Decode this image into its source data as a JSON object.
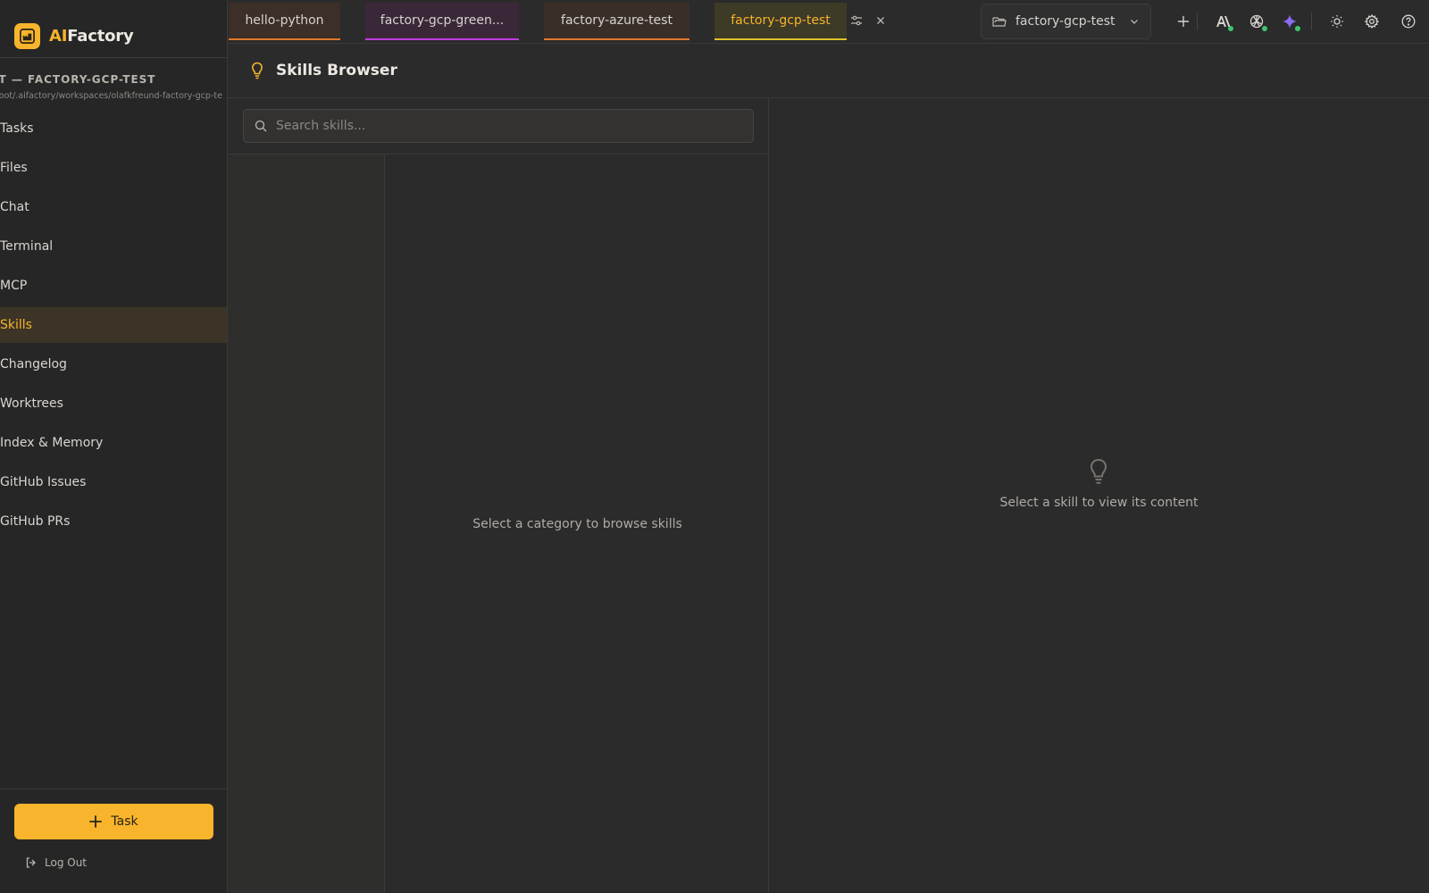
{
  "brand": {
    "prefix": "AI",
    "suffix": "Factory",
    "accent": "#f7b42c"
  },
  "project": {
    "title": "JECT — FACTORY-GCP-TEST",
    "path": "/nonroot/.aifactory/workspaces/olafkfreund-factory-gcp-te"
  },
  "nav": {
    "items": [
      {
        "label": "Tasks"
      },
      {
        "label": "Files"
      },
      {
        "label": "Chat"
      },
      {
        "label": "Terminal"
      },
      {
        "label": "MCP"
      },
      {
        "label": "Skills",
        "active": true
      },
      {
        "label": "Changelog"
      },
      {
        "label": "Worktrees"
      },
      {
        "label": "Index & Memory"
      },
      {
        "label": "GitHub Issues"
      },
      {
        "label": "GitHub PRs"
      }
    ]
  },
  "sidebar_footer": {
    "task_button": "Task",
    "logout": "Log Out"
  },
  "tabs": [
    {
      "label": "hello-python",
      "color": "#e0782c"
    },
    {
      "label": "factory-gcp-green...",
      "color": "#c23be0"
    },
    {
      "label": "factory-azure-test",
      "color": "#e0782c"
    },
    {
      "label": "factory-gcp-test",
      "color": "#e0c22c",
      "active": true
    }
  ],
  "project_selector": {
    "value": "factory-gcp-test"
  },
  "toolbar_icons": [
    "plus-icon",
    "anthropic-icon",
    "openai-icon",
    "gemini-icon",
    "sun-icon",
    "gear-icon",
    "help-icon"
  ],
  "page": {
    "title": "Skills Browser"
  },
  "search": {
    "placeholder": "Search skills..."
  },
  "skills_empty": "Select a category to browse skills",
  "content_empty": "Select a skill to view its content"
}
